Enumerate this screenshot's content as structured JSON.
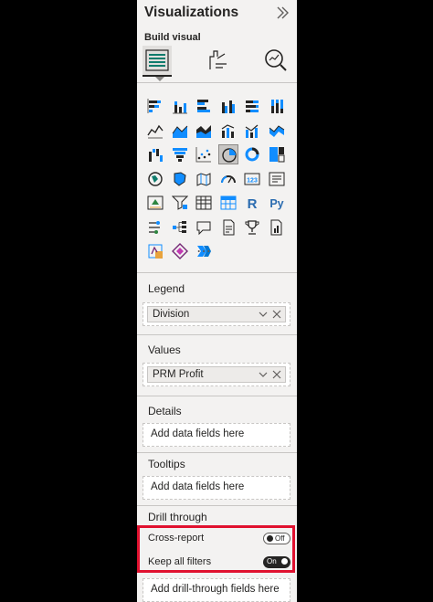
{
  "pane": {
    "title": "Visualizations",
    "subtitle": "Build visual",
    "tabs": [
      {
        "icon": "build-visual-icon"
      },
      {
        "icon": "format-visual-icon"
      },
      {
        "icon": "analytics-icon"
      }
    ],
    "more_visuals": "⋯"
  },
  "fields": {
    "legend": {
      "label": "Legend",
      "value": "Division"
    },
    "values": {
      "label": "Values",
      "value": "PRM Profit"
    },
    "details": {
      "label": "Details",
      "placeholder": "Add data fields here"
    },
    "tooltips": {
      "label": "Tooltips",
      "placeholder": "Add data fields here"
    }
  },
  "drill_through": {
    "label": "Drill through",
    "cross_report": {
      "label": "Cross-report",
      "state": "Off"
    },
    "keep_all_filters": {
      "label": "Keep all filters",
      "state": "On"
    },
    "placeholder": "Add drill-through fields here"
  },
  "colors": {
    "accent": "#118dff",
    "highlight_border": "#e0112f",
    "pane_bg": "#f3f2f1"
  }
}
